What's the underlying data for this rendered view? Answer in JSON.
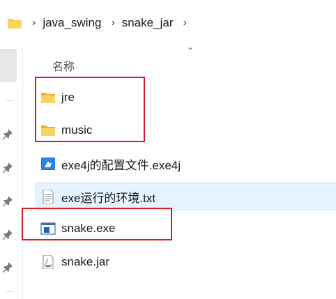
{
  "breadcrumb": {
    "segments": [
      "java_swing",
      "snake_jar"
    ]
  },
  "header": {
    "column_name": "名称"
  },
  "files": [
    {
      "name": "jre",
      "icon": "folder-icon"
    },
    {
      "name": "music",
      "icon": "folder-icon"
    },
    {
      "name": "exe4j的配置文件.exe4j",
      "icon": "exe4j-config-icon"
    },
    {
      "name": "exe运行的环境.txt",
      "icon": "text-file-icon"
    },
    {
      "name": "snake.exe",
      "icon": "exe-app-icon"
    },
    {
      "name": "snake.jar",
      "icon": "java-jar-icon"
    }
  ],
  "colors": {
    "folder": "#f8c84a",
    "hover_row": "#e5f3ff",
    "annotation": "#d91c24",
    "exe_blue": "#1565c0"
  }
}
